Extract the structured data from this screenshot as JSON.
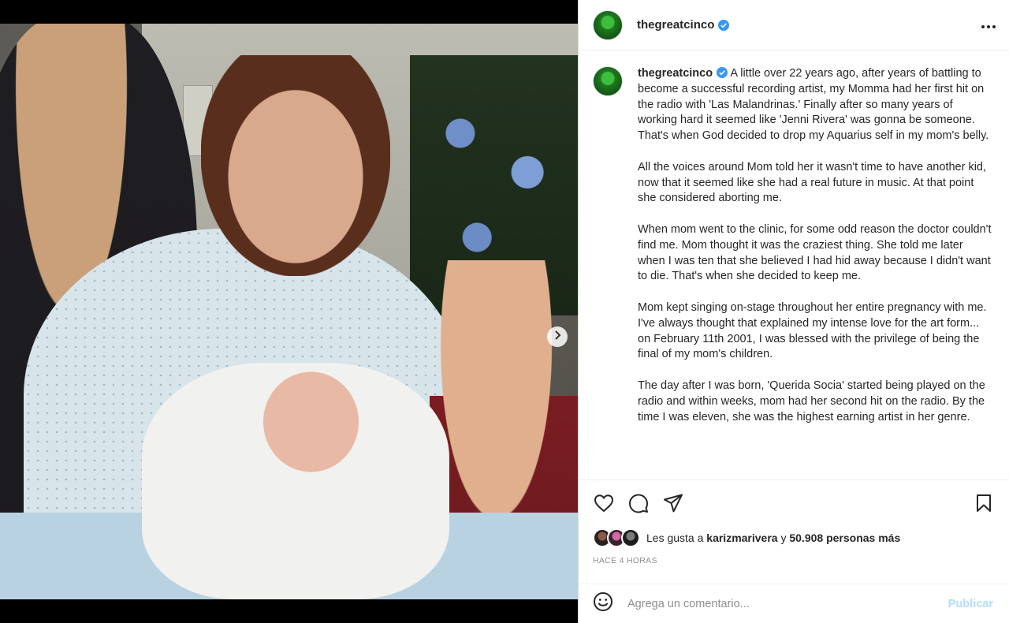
{
  "post": {
    "username": "thegreatcinco",
    "verified": true,
    "more_icon": "more-horizontal-icon",
    "carousel": {
      "slides": 5,
      "active_index": 0,
      "next_icon": "chevron-right-icon"
    },
    "caption": {
      "username": "thegreatcinco",
      "paragraphs": [
        "A little over 22 years ago, after years of battling to become a successful recording artist, my Momma had her first hit on the radio with 'Las Malandrinas.' Finally after so many years of working hard it seemed like 'Jenni Rivera' was gonna be someone. That's when God decided to drop my Aquarius self in my mom's belly.",
        "All the voices around Mom told her it wasn't time to have another kid, now that it seemed like she had a real future in music. At that point she considered aborting me.",
        "When mom went to the clinic, for some odd reason the doctor couldn't find me. Mom thought it was the craziest thing. She told me later when I was ten that she believed I had hid away because I didn't want to die. That's when she decided to keep me.",
        "Mom kept singing on-stage throughout her entire pregnancy with me. I've always thought that explained my intense love for the art form... on February 11th 2001, I was blessed with the privilege of being the final of my mom's children.",
        "The day after I was born, 'Querida Socia' started being played on the radio and within weeks, mom had her second hit on the radio. By the time I was eleven, she was the highest earning artist in her genre."
      ]
    },
    "actions": {
      "like_icon": "heart-icon",
      "comment_icon": "comment-icon",
      "share_icon": "paper-plane-icon",
      "save_icon": "bookmark-icon"
    },
    "likes": {
      "prefix": "Les gusta a",
      "user": "karizmarivera",
      "connector": "y",
      "others": "50.908 personas más"
    },
    "timestamp": "HACE 4 HORAS",
    "comment": {
      "emoji_icon": "smiley-icon",
      "placeholder": "Agrega un comentario...",
      "publish_label": "Publicar"
    }
  },
  "colors": {
    "verified": "#3897f0",
    "publish_disabled": "#b3dbff",
    "text": "#262626",
    "muted": "#8e8e8e"
  }
}
